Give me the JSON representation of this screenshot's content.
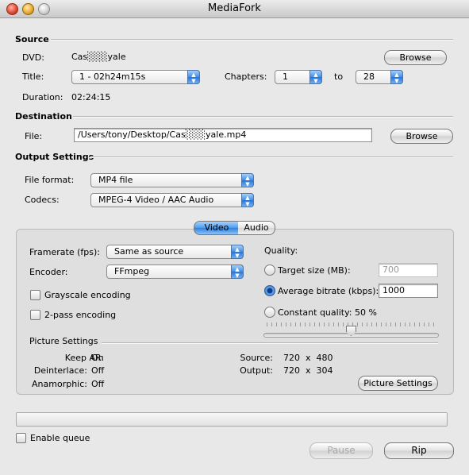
{
  "window": {
    "title": "MediaFork"
  },
  "source": {
    "heading": "Source",
    "dvd_label": "DVD:",
    "dvd_value": "Cas░░░yale",
    "browse_label": "Browse",
    "title_label": "Title:",
    "title_value": "1 - 02h24m15s",
    "chapters_label": "Chapters:",
    "chapter_start": "1",
    "to_label": "to",
    "chapter_end": "28",
    "duration_label": "Duration:",
    "duration_value": "02:24:15"
  },
  "destination": {
    "heading": "Destination",
    "file_label": "File:",
    "file_value": "/Users/tony/Desktop/Cas░░░yale.mp4",
    "browse_label": "Browse"
  },
  "output": {
    "heading": "Output Settings",
    "format_label": "File format:",
    "format_value": "MP4 file",
    "codecs_label": "Codecs:",
    "codecs_value": "MPEG-4 Video / AAC Audio"
  },
  "tabs": {
    "video": "Video",
    "audio": "Audio",
    "active": "Video"
  },
  "video": {
    "framerate_label": "Framerate (fps):",
    "framerate_value": "Same as source",
    "encoder_label": "Encoder:",
    "encoder_value": "FFmpeg",
    "grayscale_label": "Grayscale encoding",
    "twopass_label": "2-pass encoding",
    "quality_label": "Quality:",
    "target_size_label": "Target size (MB):",
    "target_size_value": "700",
    "avg_bitrate_label": "Average bitrate (kbps):",
    "avg_bitrate_value": "1000",
    "constant_quality_label": "Constant quality: 50 %",
    "selected_quality_mode": "Average bitrate (kbps):",
    "constant_quality_slider": 0.5
  },
  "picture": {
    "heading": "Picture Settings",
    "keep_ar_label": "Keep AR:",
    "keep_ar_value": "On",
    "deinterlace_label": "Deinterlace:",
    "deinterlace_value": "Off",
    "anamorphic_label": "Anamorphic:",
    "anamorphic_value": "Off",
    "source_label": "Source:",
    "source_value": "720  x  480",
    "output_label": "Output:",
    "output_value": "720  x  304",
    "button_label": "Picture Settings"
  },
  "footer": {
    "enable_queue_label": "Enable queue",
    "pause_label": "Pause",
    "rip_label": "Rip",
    "progress": 0
  }
}
